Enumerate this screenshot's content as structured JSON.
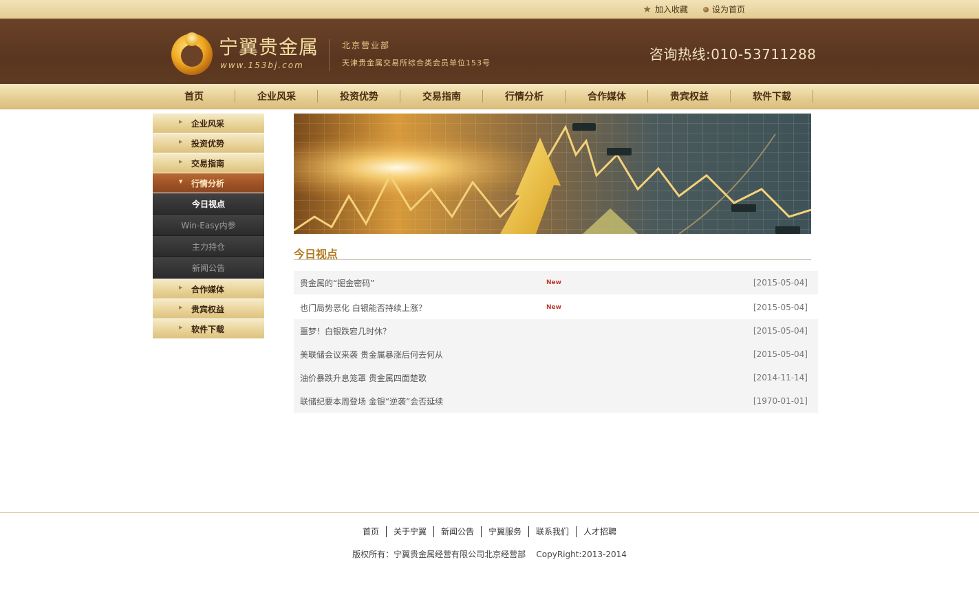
{
  "topbar": {
    "favorite_label": "加入收藏",
    "homepage_label": "设为首页"
  },
  "header": {
    "brand_name": "宁翼贵金属",
    "brand_url": "www.153bj.com",
    "department": "北京营业部",
    "member_info": "天津贵金属交易所综合类会员单位153号",
    "hotline": "咨询热线:010-53711288"
  },
  "nav": {
    "items": [
      "首页",
      "企业风采",
      "投资优势",
      "交易指南",
      "行情分析",
      "合作媒体",
      "贵宾权益",
      "软件下载"
    ]
  },
  "sidebar": {
    "top_items": [
      "企业风采",
      "投资优势",
      "交易指南"
    ],
    "active_item": "行情分析",
    "sub_items": [
      "今日视点",
      "Win-Easy内参",
      "主力持仓",
      "新闻公告"
    ],
    "bottom_items": [
      "合作媒体",
      "贵宾权益",
      "软件下载"
    ]
  },
  "section": {
    "title": "今日视点"
  },
  "news": {
    "new_badge": "New",
    "rows": [
      {
        "title": "贵金属的“掘金密码”",
        "date": "[2015-05-04]"
      },
      {
        "title": "也门局势恶化 白银能否持续上涨？",
        "date": "[2015-05-04]"
      },
      {
        "title": "噩梦！白银跌宕几时休？",
        "date": "[2015-05-04]"
      },
      {
        "title": "美联储会议来袭 贵金属暴涨后何去何从",
        "date": "[2015-05-04]"
      },
      {
        "title": "油价暴跌升息笼罩 贵金属四面楚歌",
        "date": "[2014-11-14]"
      },
      {
        "title": "联储纪要本周登场 金银“逆袭”会否延续",
        "date": "[1970-01-01]"
      }
    ]
  },
  "footer": {
    "links": [
      "首页",
      "关于宁翼",
      "新闻公告",
      "宁翼服务",
      "联系我们",
      "人才招聘"
    ],
    "copyright": "版权所有：宁翼贵金属经营有限公司北京经营部    CopyRight:2013-2014"
  },
  "colors": {
    "header_bg": "#5a3620",
    "nav_gold": "#e6cf94",
    "active_item": "#9c5125",
    "section_title": "#b07a1e",
    "new_badge": "#c0392b"
  }
}
